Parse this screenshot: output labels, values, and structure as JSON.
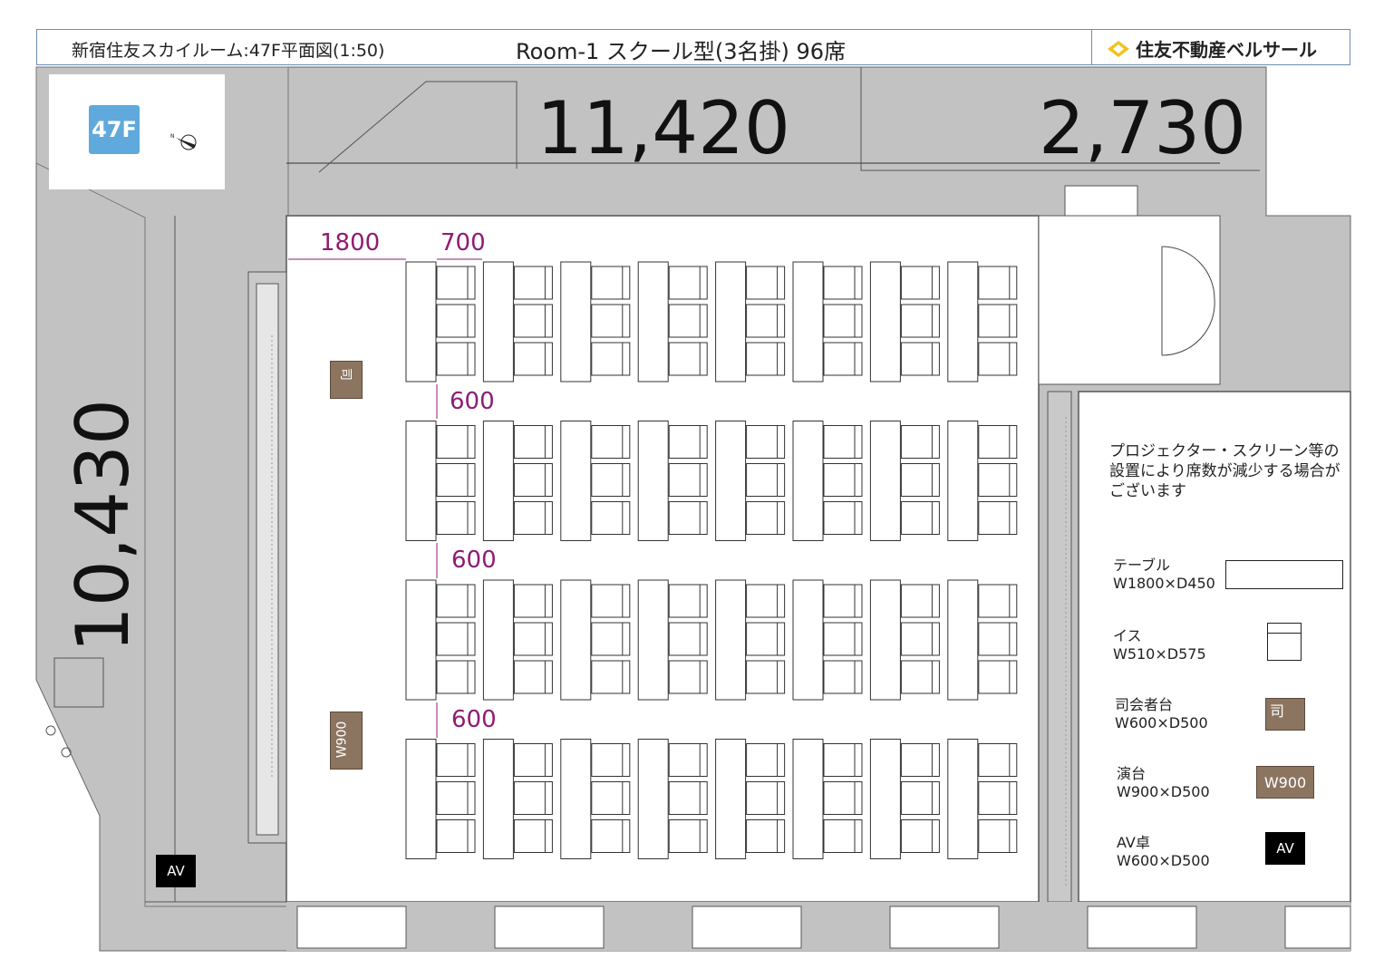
{
  "header": {
    "title": "新宿住友スカイルーム:47F平面図(1:50)",
    "room": "Room-1 スクール型(3名掛) 96席",
    "brand": "住友不動産ベルサール"
  },
  "floor": {
    "label": "47F",
    "compass": "N"
  },
  "dimensions": {
    "width_main": "11,420",
    "width_side": "2,730",
    "depth": "10,430",
    "front_gap": "1800",
    "table_pitch": "700",
    "aisle_1": "600",
    "aisle_2": "600",
    "aisle_3": "600"
  },
  "layout": {
    "style": "school",
    "blocks": 4,
    "tables_per_block": 8,
    "chairs_per_table": 3,
    "total_seats": 96
  },
  "furniture": {
    "mc_label": "司",
    "podium_label": "W900",
    "av_label": "AV"
  },
  "legend": {
    "note": "プロジェクター・スクリーン等の設置により席数が減少する場合がございます",
    "table_name": "テーブル",
    "table_size": "W1800×D450",
    "chair_name": "イス",
    "chair_size": "W510×D575",
    "mc_name": "司会者台",
    "mc_size": "W600×D500",
    "mc_symbol": "司",
    "podium_name": "演台",
    "podium_size": "W900×D500",
    "podium_symbol": "W900",
    "av_name": "AV卓",
    "av_size": "W600×D500",
    "av_symbol": "AV"
  },
  "colors": {
    "wall": "#c2c2c2",
    "floor": "#ffffff",
    "dimension_accent": "#8e1c74",
    "floor_badge": "#5fa9dc",
    "wood": "#8b7561",
    "frame": "#6a8fb8"
  }
}
